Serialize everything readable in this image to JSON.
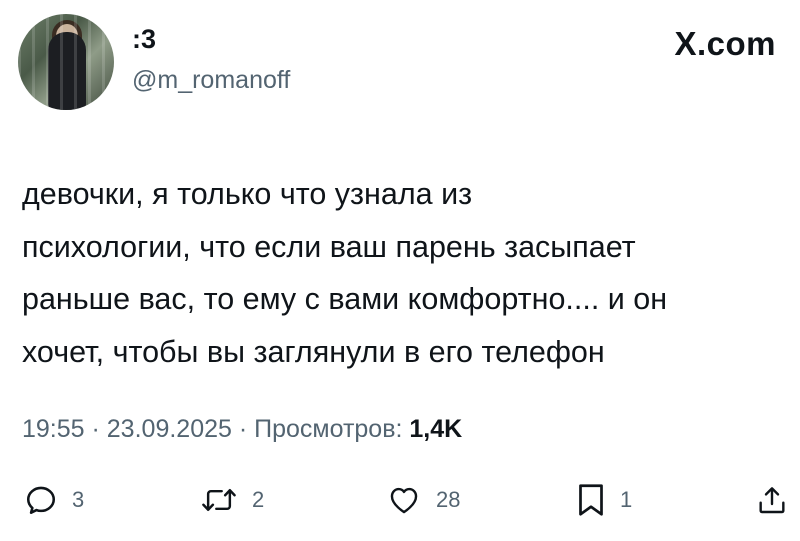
{
  "user": {
    "display_name": ":3",
    "handle": "@m_romanoff"
  },
  "brand": {
    "label": "X.com"
  },
  "tweet": {
    "lines": [
      "девочки, я только что узнала из",
      "психологии, что если ваш парень засыпает",
      "раньше вас, то ему с вами комфортно.... и он",
      "хочет, чтобы вы заглянули в его телефон"
    ]
  },
  "meta": {
    "time": "19:55",
    "sep1": " · ",
    "date": "23.09.2025",
    "sep2": " · ",
    "views_label": "Просмотров: ",
    "views_count": "1,4K"
  },
  "actions": {
    "replies": "3",
    "reposts": "2",
    "likes": "28",
    "bookmarks": "1"
  },
  "icons": {
    "reply": "reply-icon",
    "repost": "repost-icon",
    "like": "heart-icon",
    "bookmark": "bookmark-icon",
    "share": "share-icon"
  },
  "colors": {
    "text": "#0f1419",
    "secondary": "#536471",
    "background": "#ffffff"
  }
}
